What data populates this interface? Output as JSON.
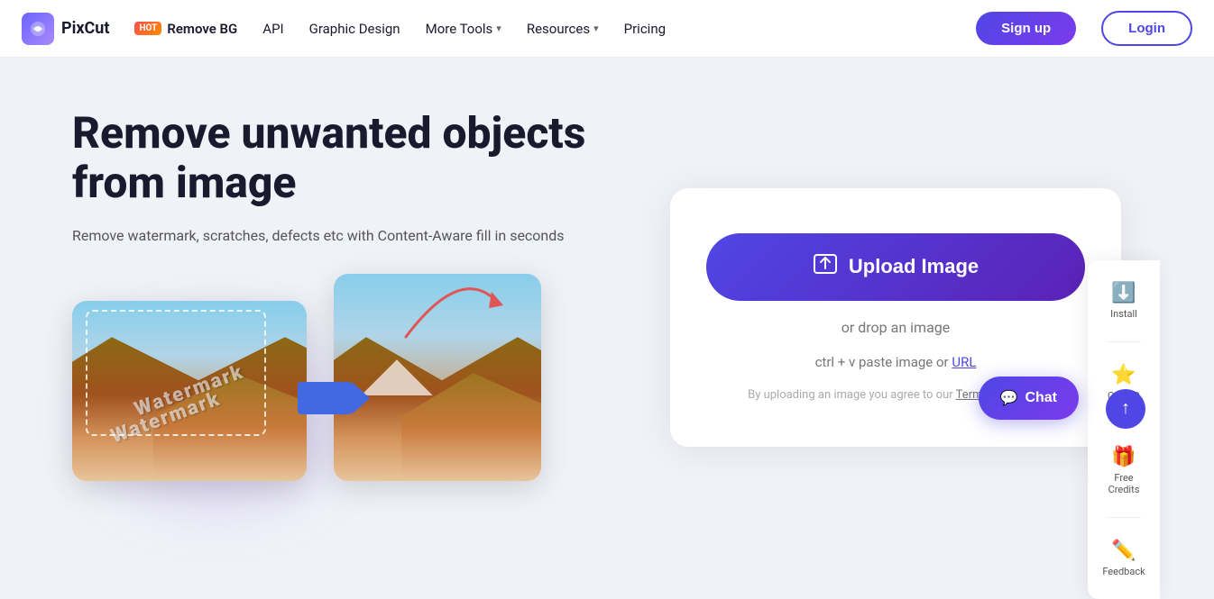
{
  "navbar": {
    "logo_text": "PixCut",
    "hot_badge": "HOT",
    "remove_bg": "Remove BG",
    "api": "API",
    "graphic_design": "Graphic Design",
    "more_tools": "More Tools",
    "resources": "Resources",
    "pricing": "Pricing",
    "signup": "Sign up",
    "login": "Login"
  },
  "hero": {
    "title": "Remove unwanted objects from image",
    "subtitle": "Remove watermark, scratches, defects etc with Content-Aware fill in seconds"
  },
  "upload": {
    "button_label": "Upload Image",
    "drop_text": "or drop an image",
    "paste_text": "ctrl + v paste image or",
    "paste_link": "URL",
    "tos_prefix": "By uploading an image you agree to our",
    "tos_link": "Terms of Service"
  },
  "side_panel": {
    "install_label": "Install",
    "shortcut_label": "Ctrl + D",
    "credits_label": "Free Credits",
    "feedback_label": "Feedback"
  },
  "chat": {
    "button_label": "Chat"
  },
  "watermark1": "Watermark",
  "watermark2": "Watermark"
}
